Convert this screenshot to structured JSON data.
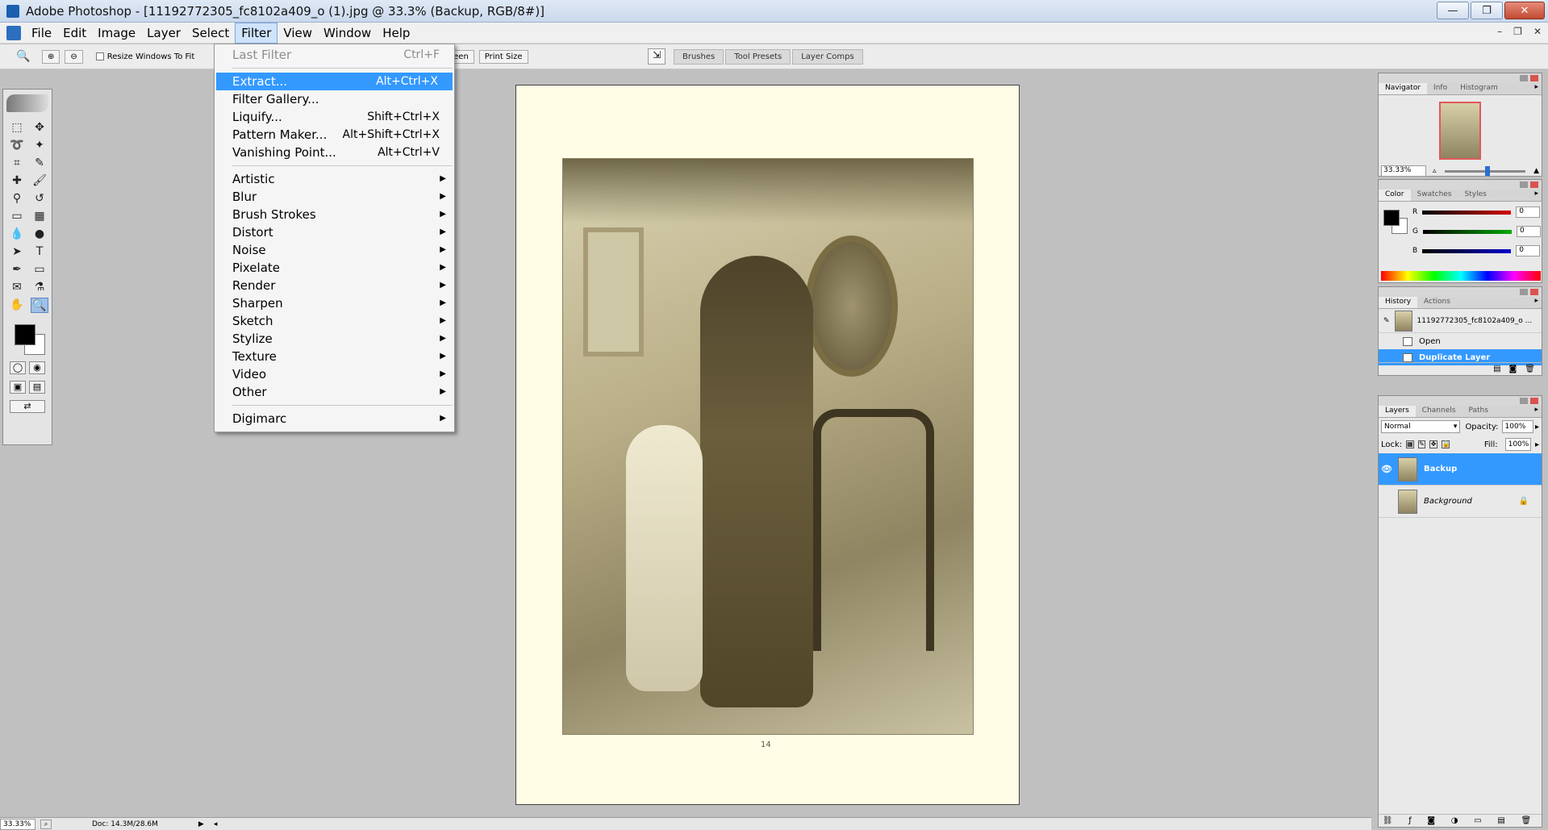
{
  "window": {
    "title": "Adobe Photoshop - [11192772305_fc8102a409_o (1).jpg @ 33.3% (Backup, RGB/8#)]",
    "buttons": {
      "minimize": "—",
      "restore": "❐",
      "close": "✕"
    }
  },
  "menubar": {
    "items": [
      "File",
      "Edit",
      "Image",
      "Layer",
      "Select",
      "Filter",
      "View",
      "Window",
      "Help"
    ],
    "active": "Filter",
    "doc_controls": [
      "–",
      "❐",
      "✕"
    ]
  },
  "options_bar": {
    "resize_windows_label": "Resize Windows To Fit",
    "screen_label": "reen",
    "print_size_label": "Print Size",
    "palette_tabs": [
      "Brushes",
      "Tool Presets",
      "Layer Comps"
    ]
  },
  "filter_menu": {
    "last_filter": {
      "label": "Last Filter",
      "shortcut": "Ctrl+F"
    },
    "top_items": [
      {
        "label": "Extract...",
        "shortcut": "Alt+Ctrl+X"
      },
      {
        "label": "Filter Gallery...",
        "shortcut": ""
      },
      {
        "label": "Liquify...",
        "shortcut": "Shift+Ctrl+X"
      },
      {
        "label": "Pattern Maker...",
        "shortcut": "Alt+Shift+Ctrl+X"
      },
      {
        "label": "Vanishing Point...",
        "shortcut": "Alt+Ctrl+V"
      }
    ],
    "highlighted": "Extract...",
    "submenus": [
      "Artistic",
      "Blur",
      "Brush Strokes",
      "Distort",
      "Noise",
      "Pixelate",
      "Render",
      "Sharpen",
      "Sketch",
      "Stylize",
      "Texture",
      "Video",
      "Other"
    ],
    "plugins": [
      "Digimarc"
    ]
  },
  "canvas": {
    "page_number": "14"
  },
  "navigator": {
    "tabs": [
      "Navigator",
      "Info",
      "Histogram"
    ],
    "zoom": "33.33%"
  },
  "color_panel": {
    "tabs": [
      "Color",
      "Swatches",
      "Styles"
    ],
    "channels": [
      {
        "name": "R",
        "value": "0",
        "color": "#d40000"
      },
      {
        "name": "G",
        "value": "0",
        "color": "#00a800"
      },
      {
        "name": "B",
        "value": "0",
        "color": "#0000cc"
      }
    ]
  },
  "history": {
    "tabs": [
      "History",
      "Actions"
    ],
    "snapshot": "11192772305_fc8102a409_o ...",
    "steps": [
      {
        "label": "Open",
        "selected": false
      },
      {
        "label": "Duplicate Layer",
        "selected": true
      }
    ]
  },
  "layers": {
    "tabs": [
      "Layers",
      "Channels",
      "Paths"
    ],
    "blend_mode": "Normal",
    "opacity_label": "Opacity:",
    "opacity": "100%",
    "lock_label": "Lock:",
    "fill_label": "Fill:",
    "fill": "100%",
    "items": [
      {
        "name": "Backup",
        "selected": true,
        "visible": true,
        "locked": false
      },
      {
        "name": "Background",
        "selected": false,
        "visible": false,
        "locked": true
      }
    ]
  },
  "statusbar": {
    "zoom": "33.33%",
    "doc": "Doc: 14.3M/28.6M"
  }
}
